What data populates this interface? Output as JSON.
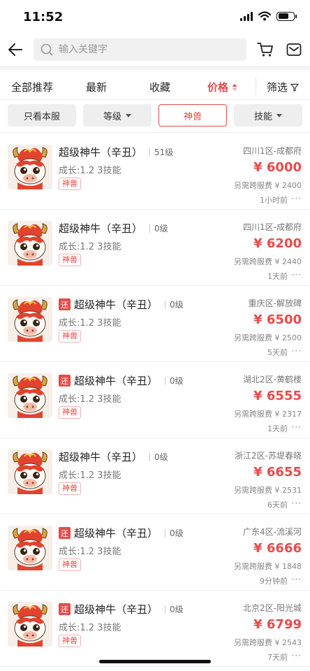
{
  "status_bar": {
    "time": "11:52"
  },
  "search": {
    "placeholder": "输入关键字"
  },
  "tabs": [
    {
      "label": "全部推荐"
    },
    {
      "label": "最新"
    },
    {
      "label": "收藏"
    },
    {
      "label": "价格",
      "active": true
    },
    {
      "label": "筛选"
    }
  ],
  "filters": [
    {
      "label": "只看本服"
    },
    {
      "label": "等级"
    },
    {
      "label": "神兽",
      "active": true
    },
    {
      "label": "技能"
    }
  ],
  "colors": {
    "accent": "#e94a4a",
    "text": "#222222",
    "muted": "#888888"
  },
  "items": [
    {
      "return_badge": "",
      "title": "超级神牛（辛丑）",
      "level": "51级",
      "growth": "成长:1.2 3技能",
      "tag": "神兽",
      "server": "四川1区-成都府",
      "price": "¥ 6000",
      "fee": "另需跨服费 ¥ 2400",
      "time": "1小时前",
      "more": "···"
    },
    {
      "return_badge": "",
      "title": "超级神牛（辛丑）",
      "level": "0级",
      "growth": "成长:1.2 3技能",
      "tag": "神兽",
      "server": "四川1区-成都府",
      "price": "¥ 6200",
      "fee": "另需跨服费 ¥ 2440",
      "time": "1天前",
      "more": "···"
    },
    {
      "return_badge": "还",
      "title": "超级神牛（辛丑）",
      "level": "0级",
      "growth": "成长:1.2 3技能",
      "tag": "神兽",
      "server": "重庆区-解放碑",
      "price": "¥ 6500",
      "fee": "另需跨服费 ¥ 2500",
      "time": "5天前",
      "more": "···"
    },
    {
      "return_badge": "还",
      "title": "超级神牛（辛丑）",
      "level": "0级",
      "growth": "成长:1.2 3技能",
      "tag": "神兽",
      "server": "湖北2区-黄鹤楼",
      "price": "¥ 6555",
      "fee": "另需跨服费 ¥ 2317",
      "time": "1天前",
      "more": "···"
    },
    {
      "return_badge": "",
      "title": "超级神牛（辛丑）",
      "level": "0级",
      "growth": "成长:1.2 3技能",
      "tag": "神兽",
      "server": "浙江2区-苏堤春晓",
      "price": "¥ 6655",
      "fee": "另需跨服费 ¥ 2531",
      "time": "6天前",
      "more": "···"
    },
    {
      "return_badge": "还",
      "title": "超级神牛（辛丑）",
      "level": "0级",
      "growth": "成长:1.2 3技能",
      "tag": "神兽",
      "server": "广东4区-流溪河",
      "price": "¥ 6666",
      "fee": "另需跨服费 ¥ 1848",
      "time": "9分钟前",
      "more": "···"
    },
    {
      "return_badge": "还",
      "title": "超级神牛（辛丑）",
      "level": "0级",
      "growth": "成长:1.2 3技能",
      "tag": "神兽",
      "server": "北京2区-阳光城",
      "price": "¥ 6799",
      "fee": "另需跨服费 ¥ 2543",
      "time": "7天前",
      "more": "···"
    }
  ]
}
